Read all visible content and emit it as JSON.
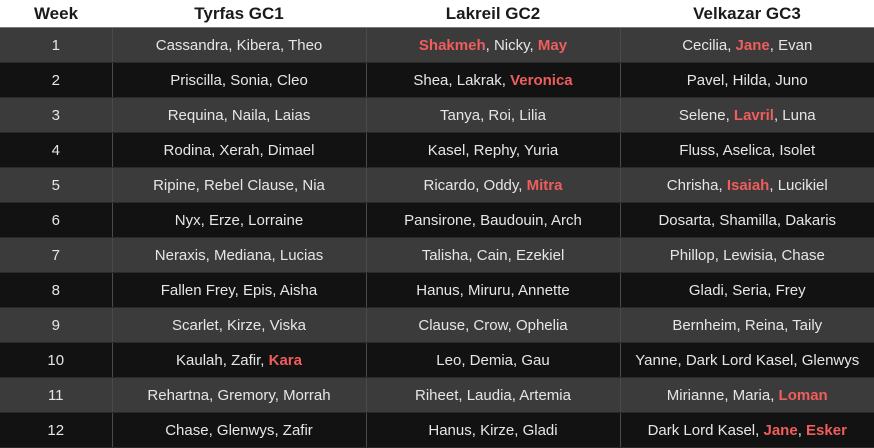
{
  "headers": [
    "Week",
    "Tyrfas GC1",
    "Lakreil GC2",
    "Velkazar GC3"
  ],
  "rows": [
    {
      "week": "1",
      "cells": [
        [
          {
            "t": "Cassandra"
          },
          {
            "t": "Kibera"
          },
          {
            "t": "Theo"
          }
        ],
        [
          {
            "t": "Shakmeh",
            "hl": true
          },
          {
            "t": "Nicky"
          },
          {
            "t": "May",
            "hl": true
          }
        ],
        [
          {
            "t": "Cecilia"
          },
          {
            "t": "Jane",
            "hl": true
          },
          {
            "t": "Evan"
          }
        ]
      ]
    },
    {
      "week": "2",
      "cells": [
        [
          {
            "t": "Priscilla"
          },
          {
            "t": "Sonia"
          },
          {
            "t": "Cleo"
          }
        ],
        [
          {
            "t": "Shea"
          },
          {
            "t": "Lakrak"
          },
          {
            "t": "Veronica",
            "hl": true
          }
        ],
        [
          {
            "t": "Pavel"
          },
          {
            "t": "Hilda"
          },
          {
            "t": "Juno"
          }
        ]
      ]
    },
    {
      "week": "3",
      "cells": [
        [
          {
            "t": "Requina"
          },
          {
            "t": "Naila"
          },
          {
            "t": "Laias"
          }
        ],
        [
          {
            "t": "Tanya"
          },
          {
            "t": "Roi"
          },
          {
            "t": "Lilia"
          }
        ],
        [
          {
            "t": "Selene"
          },
          {
            "t": "Lavril",
            "hl": true
          },
          {
            "t": "Luna"
          }
        ]
      ]
    },
    {
      "week": "4",
      "cells": [
        [
          {
            "t": "Rodina"
          },
          {
            "t": "Xerah"
          },
          {
            "t": "Dimael"
          }
        ],
        [
          {
            "t": "Kasel"
          },
          {
            "t": "Rephy"
          },
          {
            "t": "Yuria"
          }
        ],
        [
          {
            "t": "Fluss"
          },
          {
            "t": "Aselica"
          },
          {
            "t": "Isolet"
          }
        ]
      ]
    },
    {
      "week": "5",
      "cells": [
        [
          {
            "t": "Ripine"
          },
          {
            "t": "Rebel Clause"
          },
          {
            "t": "Nia"
          }
        ],
        [
          {
            "t": "Ricardo"
          },
          {
            "t": "Oddy"
          },
          {
            "t": "Mitra",
            "hl": true
          }
        ],
        [
          {
            "t": "Chrisha"
          },
          {
            "t": "Isaiah",
            "hl": true
          },
          {
            "t": "Lucikiel"
          }
        ]
      ]
    },
    {
      "week": "6",
      "cells": [
        [
          {
            "t": "Nyx"
          },
          {
            "t": "Erze"
          },
          {
            "t": "Lorraine"
          }
        ],
        [
          {
            "t": "Pansirone"
          },
          {
            "t": "Baudouin"
          },
          {
            "t": "Arch"
          }
        ],
        [
          {
            "t": "Dosarta"
          },
          {
            "t": "Shamilla"
          },
          {
            "t": "Dakaris"
          }
        ]
      ]
    },
    {
      "week": "7",
      "cells": [
        [
          {
            "t": "Neraxis"
          },
          {
            "t": "Mediana"
          },
          {
            "t": "Lucias"
          }
        ],
        [
          {
            "t": "Talisha"
          },
          {
            "t": "Cain"
          },
          {
            "t": "Ezekiel"
          }
        ],
        [
          {
            "t": "Phillop"
          },
          {
            "t": "Lewisia"
          },
          {
            "t": "Chase"
          }
        ]
      ]
    },
    {
      "week": "8",
      "cells": [
        [
          {
            "t": "Fallen Frey"
          },
          {
            "t": "Epis"
          },
          {
            "t": "Aisha"
          }
        ],
        [
          {
            "t": "Hanus"
          },
          {
            "t": "Miruru"
          },
          {
            "t": "Annette"
          }
        ],
        [
          {
            "t": "Gladi"
          },
          {
            "t": "Seria"
          },
          {
            "t": "Frey"
          }
        ]
      ]
    },
    {
      "week": "9",
      "cells": [
        [
          {
            "t": "Scarlet"
          },
          {
            "t": "Kirze"
          },
          {
            "t": "Viska"
          }
        ],
        [
          {
            "t": "Clause"
          },
          {
            "t": "Crow"
          },
          {
            "t": "Ophelia"
          }
        ],
        [
          {
            "t": "Bernheim"
          },
          {
            "t": "Reina"
          },
          {
            "t": "Taily"
          }
        ]
      ]
    },
    {
      "week": "10",
      "cells": [
        [
          {
            "t": "Kaulah"
          },
          {
            "t": "Zafir"
          },
          {
            "t": "Kara",
            "hl": true
          }
        ],
        [
          {
            "t": "Leo"
          },
          {
            "t": "Demia"
          },
          {
            "t": "Gau"
          }
        ],
        [
          {
            "t": "Yanne"
          },
          {
            "t": "Dark Lord Kasel"
          },
          {
            "t": "Glenwys"
          }
        ]
      ]
    },
    {
      "week": "11",
      "cells": [
        [
          {
            "t": "Rehartna"
          },
          {
            "t": "Gremory"
          },
          {
            "t": "Morrah"
          }
        ],
        [
          {
            "t": "Riheet"
          },
          {
            "t": "Laudia"
          },
          {
            "t": "Artemia"
          }
        ],
        [
          {
            "t": "Mirianne"
          },
          {
            "t": "Maria"
          },
          {
            "t": "Loman",
            "hl": true
          }
        ]
      ]
    },
    {
      "week": "12",
      "cells": [
        [
          {
            "t": "Chase"
          },
          {
            "t": "Glenwys"
          },
          {
            "t": "Zafir"
          }
        ],
        [
          {
            "t": "Hanus"
          },
          {
            "t": "Kirze"
          },
          {
            "t": "Gladi"
          }
        ],
        [
          {
            "t": "Dark Lord Kasel"
          },
          {
            "t": "Jane",
            "hl": true
          },
          {
            "t": "Esker",
            "hl": true
          }
        ]
      ]
    }
  ],
  "colors": {
    "highlight": "#ef5d5d",
    "row_odd": "#3b3b3b",
    "row_even": "#121212",
    "header_bg": "#ffffff"
  }
}
